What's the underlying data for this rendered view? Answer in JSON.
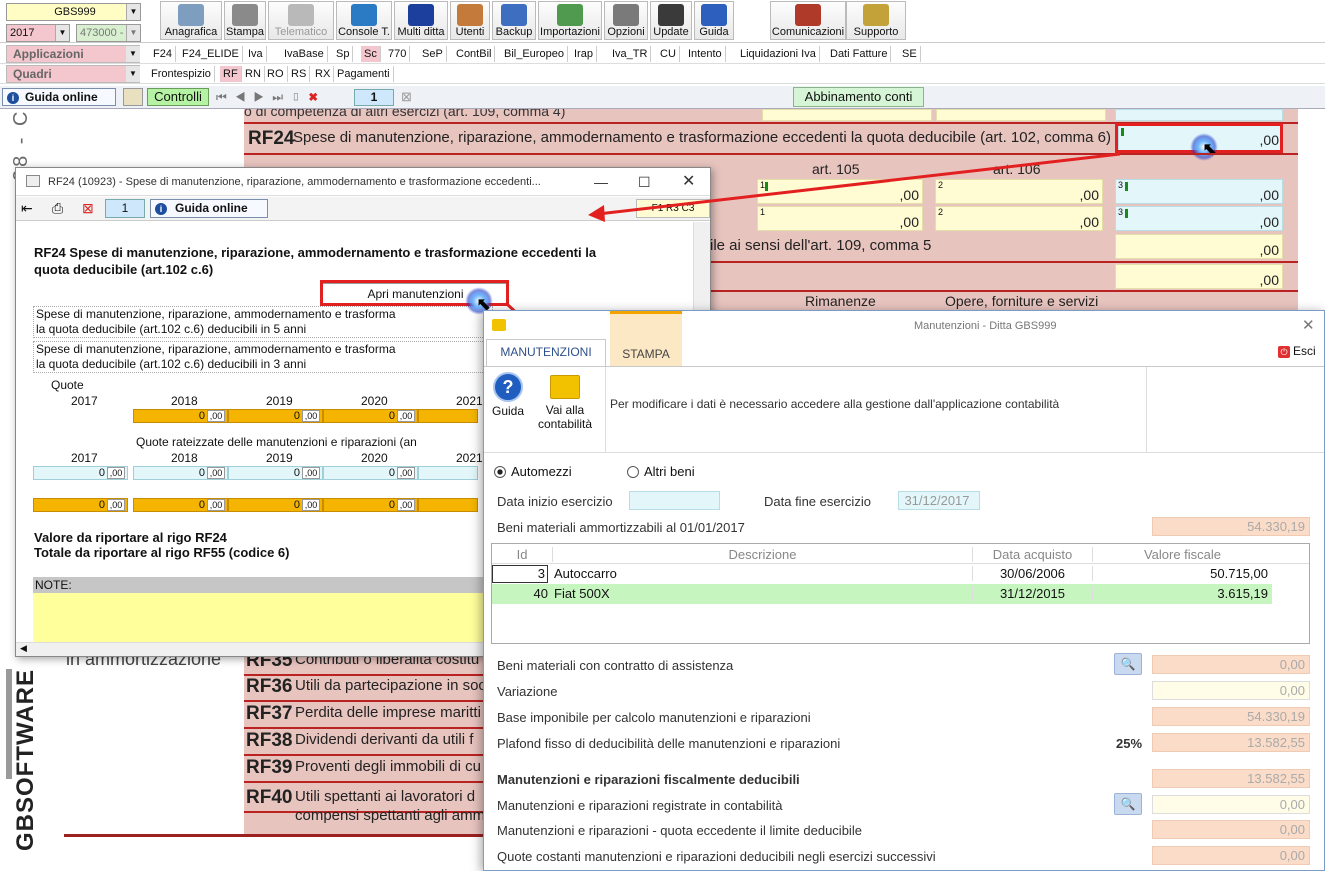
{
  "toolbar": {
    "ditta": "GBS999",
    "anno": "2017",
    "codice": "473000 -",
    "buttons": [
      {
        "label": "Anagrafica",
        "icon": "address-book-icon"
      },
      {
        "label": "Stampa",
        "icon": "printer-icon"
      },
      {
        "label": "Telematico",
        "icon": "feather-icon"
      },
      {
        "label": "Console T.",
        "icon": "monitor-icon"
      },
      {
        "label": "Multi ditta",
        "icon": "m-icon"
      },
      {
        "label": "Utenti",
        "icon": "users-icon"
      },
      {
        "label": "Backup",
        "icon": "backup-icon"
      },
      {
        "label": "Importazioni",
        "icon": "import-icon"
      },
      {
        "label": "Opzioni",
        "icon": "wrench-icon"
      },
      {
        "label": "Update",
        "icon": "update-icon"
      },
      {
        "label": "Guida",
        "icon": "help-icon"
      },
      {
        "label": "Comunicazioni",
        "icon": "comunicazioni-icon"
      },
      {
        "label": "Supporto",
        "icon": "support-icon"
      }
    ]
  },
  "menu": {
    "applicazioni_label": "Applicazioni",
    "applicazioni": [
      "F24",
      "F24_ELIDE",
      "Iva",
      "IvaBase",
      "Sp",
      "Sc",
      "770",
      "SeP",
      "ContBil",
      "Bil_Europeo",
      "Irap",
      "Iva_TR",
      "CU",
      "Intento",
      "Liquidazioni Iva",
      "Dati Fatture",
      "SE"
    ],
    "quadri_label": "Quadri",
    "quadri": [
      "Frontespizio",
      "RF",
      "RN",
      "RO",
      "RS",
      "RX",
      "Pagamenti"
    ]
  },
  "nav": {
    "guida": "Guida online",
    "controlli": "Controlli",
    "page": "1",
    "abbinamento": "Abbinamento conti"
  },
  "bgform": {
    "rf24_code": "RF24",
    "rf24_text": "Spese di manutenzione, riparazione, ammodernamento e trasformazione eccedenti la quota deducibile (art. 102, comma 6)",
    "rf24_value": ",00",
    "partial_top": "o di competenza di altri esercizi (art. 109, comma 4)",
    "art105": "art. 105",
    "art106": "art. 106",
    "zero": ",00",
    "art109": "ile ai sensi dell'art. 109, comma 5",
    "rimanenze": "Rimanenze",
    "opere": "Opere, forniture e servizi",
    "in_ammortizzazione": "in ammortizzazione",
    "rows": [
      {
        "code": "RF35",
        "text": "Contributi o liberalità costitu"
      },
      {
        "code": "RF36",
        "text": "Utili da partecipazione in soc"
      },
      {
        "code": "RF37",
        "text": "Perdita delle imprese maritti"
      },
      {
        "code": "RF38",
        "text": "Dividendi derivanti da utili f"
      },
      {
        "code": "RF39",
        "text": "Proventi degli immobili di cu"
      },
      {
        "code": "RF40",
        "text": "Utili spettanti ai lavoratori d"
      }
    ],
    "rf40_text2": "compensi spettanti agli amm",
    "side_text": "28 - C",
    "logo": "GBSOFTWARE"
  },
  "rf24win": {
    "title": "RF24 (10923) -  Spese di manutenzione, riparazione, ammodernamento e trasformazione eccedenti...",
    "page": "1",
    "guida": "Guida online",
    "side_btn": "F1 R3 C3",
    "heading": "RF24 Spese di manutenzione, riparazione, ammodernamento e trasformazione eccedenti la quota deducibile (art.102 c.6)",
    "apri": "Apri manutenzioni",
    "line1a": "Spese di manutenzione, riparazione, ammodernamento e trasforma",
    "line1b": "la quota deducibile (art.102 c.6) deducibili in 5 anni",
    "line2a": "Spese di manutenzione, riparazione, ammodernamento e trasforma",
    "line2b": "la quota deducibile (art.102 c.6) deducibili in 3 anni",
    "quote": "Quote",
    "years": [
      "2017",
      "2018",
      "2019",
      "2020",
      "2021"
    ],
    "quote_rateizzate": "Quote rateizzate delle manutenzioni e riparazioni (an",
    "zero": "0",
    "dec": ",00",
    "valore": "Valore da riportare al rigo RF24",
    "totale": "Totale da riportare al rigo  RF55 (codice 6)",
    "note": "NOTE:"
  },
  "manwin": {
    "title": "Manutenzioni - Ditta GBS999",
    "tabs": [
      "MANUTENZIONI",
      "STAMPA"
    ],
    "esci": "Esci",
    "guida": "Guida",
    "vai1": "Vai alla",
    "vai2": "contabilità",
    "info": "Per modificare i dati è necessario accedere alla gestione dall'applicazione contabilità",
    "radio1": "Automezzi",
    "radio2": "Altri beni",
    "data_inizio": "Data inizio esercizio",
    "data_inizio_val": "",
    "data_fine": "Data fine esercizio",
    "data_fine_val": "31/12/2017",
    "beni_amm": "Beni materiali ammortizzabili al 01/01/2017",
    "beni_amm_val": "54.330,19",
    "table": {
      "headers": [
        "Id",
        "Descrizione",
        "Data acquisto",
        "Valore fiscale"
      ],
      "rows": [
        {
          "id": "3",
          "desc": "Autoccarro",
          "data": "30/06/2006",
          "valore": "50.715,00"
        },
        {
          "id": "40",
          "desc": "Fiat 500X",
          "data": "31/12/2015",
          "valore": "3.615,19"
        }
      ]
    },
    "fields": [
      {
        "label": "Beni materiali con contratto di assistenza",
        "value": "0,00"
      },
      {
        "label": "Variazione",
        "value": "0,00"
      },
      {
        "label": "Base imponibile per calcolo manutenzioni e riparazioni",
        "value": "54.330,19"
      },
      {
        "label": "Plafond fisso di deducibilità delle manutenzioni e riparazioni",
        "value": "13.582,55",
        "percent": "25%"
      },
      {
        "label": "Manutenzioni e riparazioni fiscalmente deducibili",
        "value": "13.582,55"
      },
      {
        "label": "Manutenzioni e riparazioni registrate in contabilità",
        "value": "0,00"
      },
      {
        "label": "Manutenzioni e riparazioni - quota eccedente il limite deducibile",
        "value": "0,00"
      },
      {
        "label": "Quote costanti manutenzioni e riparazioni deducibili negli esercizi successivi",
        "value": "0,00"
      }
    ]
  },
  "colors": {
    "pink": "#e8c4bf",
    "accent_red": "#e32020",
    "gold": "#f4b400",
    "peach": "#fadcc8"
  }
}
